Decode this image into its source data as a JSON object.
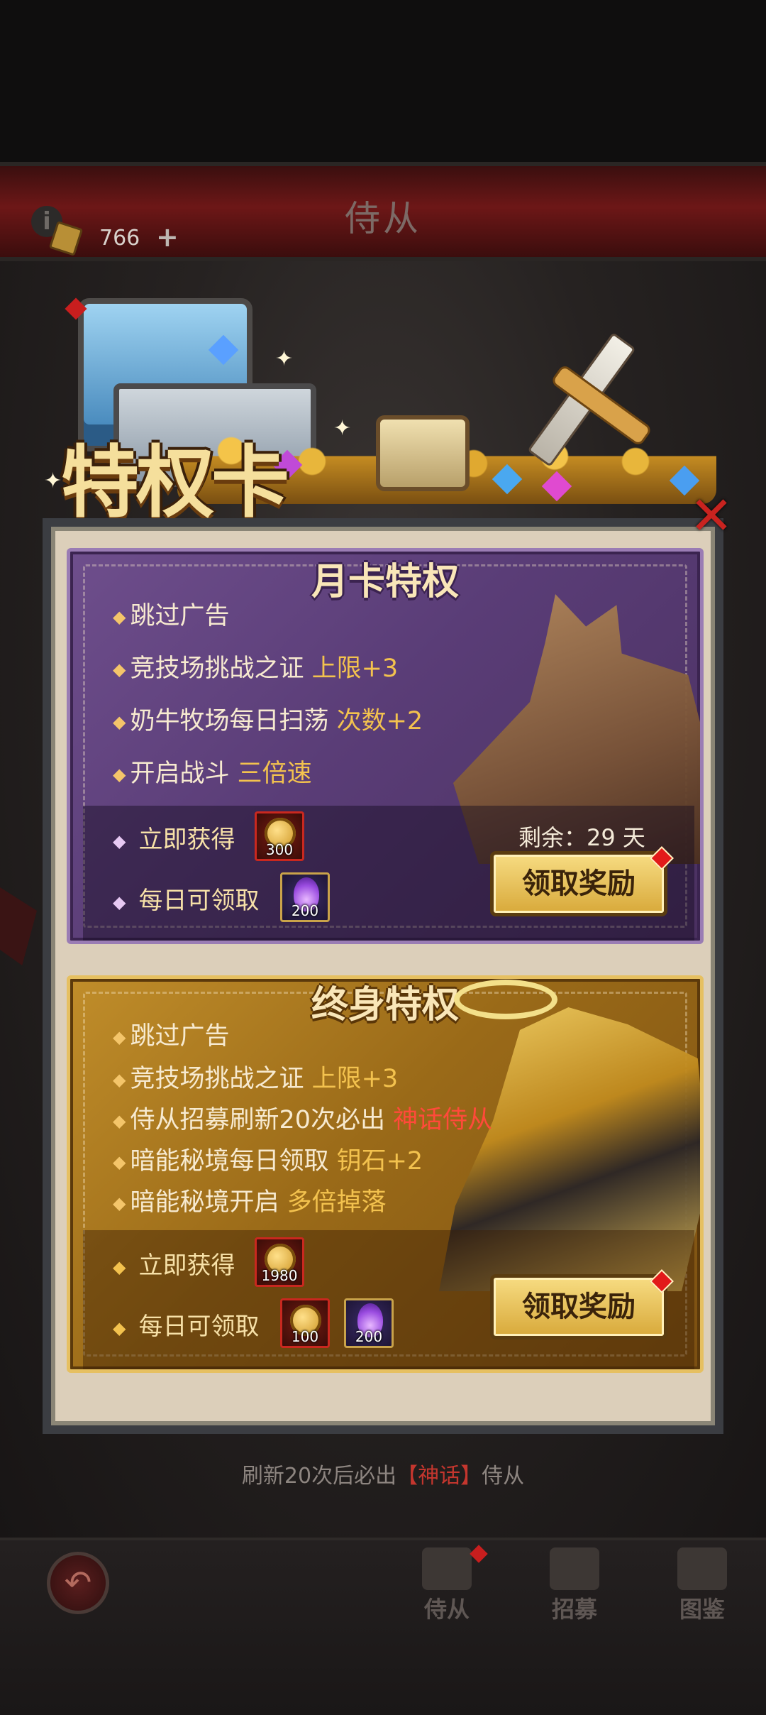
{
  "header": {
    "title": "侍从",
    "ticket_count": "766",
    "plus": "+"
  },
  "banner": {
    "title": "特权卡"
  },
  "monthly_card": {
    "title": "月卡特权",
    "perks": [
      {
        "text": "跳过广告",
        "highlight": ""
      },
      {
        "text": "竞技场挑战之证 ",
        "highlight": "上限+3"
      },
      {
        "text": "奶牛牧场每日扫荡 ",
        "highlight": "次数+2"
      },
      {
        "text": "开启战斗 ",
        "highlight": "三倍速"
      }
    ],
    "instant_label": "立即获得",
    "instant_items": [
      {
        "icon": "skull-coin-icon",
        "qty": "300"
      }
    ],
    "daily_label": "每日可领取",
    "daily_items": [
      {
        "icon": "purple-flame-icon",
        "qty": "200"
      }
    ],
    "remaining": "剩余：29 天",
    "claim_label": "领取奖励"
  },
  "lifetime_card": {
    "title": "终身特权",
    "perks": [
      {
        "text": "跳过广告",
        "highlight": ""
      },
      {
        "text": "竞技场挑战之证 ",
        "highlight": "上限+3"
      },
      {
        "text": "侍从招募刷新20次必出 ",
        "highlight": "神话侍从"
      },
      {
        "text": "暗能秘境每日领取 ",
        "highlight": "钥石+2"
      },
      {
        "text": "暗能秘境开启 ",
        "highlight": "多倍掉落"
      }
    ],
    "instant_label": "立即获得",
    "instant_items": [
      {
        "icon": "skull-coin-icon",
        "qty": "1980"
      }
    ],
    "daily_label": "每日可领取",
    "daily_items": [
      {
        "icon": "skull-coin-icon",
        "qty": "100"
      },
      {
        "icon": "purple-flame-icon",
        "qty": "200"
      }
    ],
    "claim_label": "领取奖励"
  },
  "footer_hint": {
    "prefix": "刷新20次后必出",
    "highlight": "【神话】",
    "suffix": "侍从"
  },
  "nav": {
    "items": [
      {
        "label": "侍从",
        "icon": "helmet-icon"
      },
      {
        "label": "招募",
        "icon": "flag-icon"
      },
      {
        "label": "图鉴",
        "icon": "book-icon"
      }
    ]
  },
  "colors": {
    "accent_gold": "#f3c24e",
    "mythic_red": "#ff4a3a",
    "monthly_purple": "#5a3d77",
    "lifetime_gold": "#9a6a18"
  }
}
